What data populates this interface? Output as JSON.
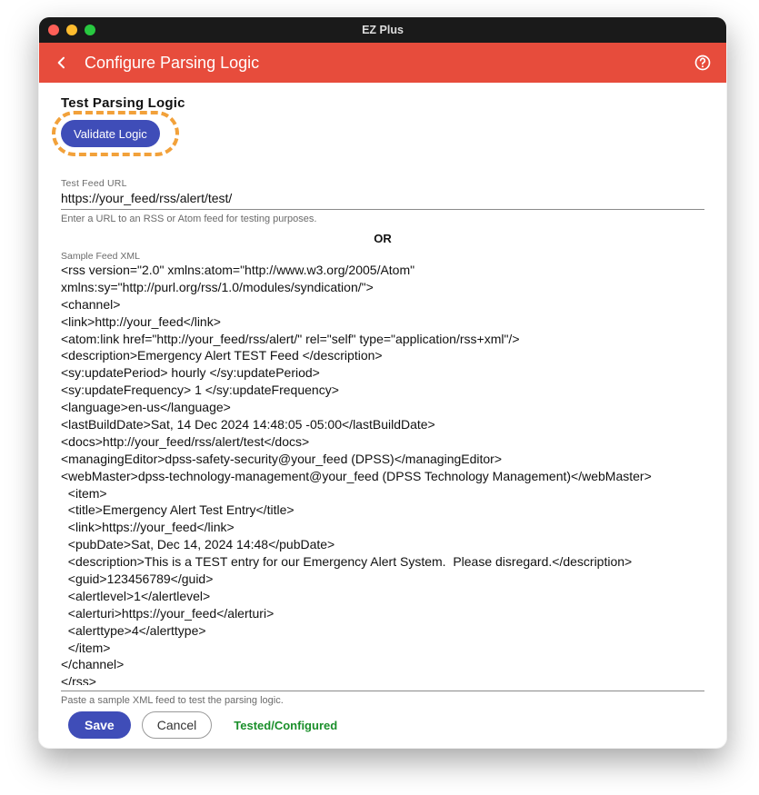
{
  "titlebar": {
    "app_title": "EZ Plus"
  },
  "header": {
    "title": "Configure Parsing Logic"
  },
  "section": {
    "title": "Test Parsing Logic"
  },
  "buttons": {
    "validate": "Validate Logic",
    "save": "Save",
    "cancel": "Cancel"
  },
  "fields": {
    "test_feed_url": {
      "label": "Test Feed URL",
      "value": "https://your_feed/rss/alert/test/",
      "hint": "Enter a URL to an RSS or Atom feed for testing purposes."
    },
    "or_label": "OR",
    "sample_xml": {
      "label": "Sample Feed XML",
      "value": "<rss version=\"2.0\" xmlns:atom=\"http://www.w3.org/2005/Atom\" xmlns:sy=\"http://purl.org/rss/1.0/modules/syndication/\">\n<channel>\n<link>http://your_feed</link>\n<atom:link href=\"http://your_feed/rss/alert/\" rel=\"self\" type=\"application/rss+xml\"/>\n<description>Emergency Alert TEST Feed </description>\n<sy:updatePeriod> hourly </sy:updatePeriod>\n<sy:updateFrequency> 1 </sy:updateFrequency>\n<language>en-us</language>\n<lastBuildDate>Sat, 14 Dec 2024 14:48:05 -05:00</lastBuildDate>\n<docs>http://your_feed/rss/alert/test</docs>\n<managingEditor>dpss-safety-security@your_feed (DPSS)</managingEditor>\n<webMaster>dpss-technology-management@your_feed (DPSS Technology Management)</webMaster>\n  <item>\n  <title>Emergency Alert Test Entry</title>\n  <link>https://your_feed</link>\n  <pubDate>Sat, Dec 14, 2024 14:48</pubDate>\n  <description>This is a TEST entry for our Emergency Alert System.  Please disregard.</description>\n  <guid>123456789</guid>\n  <alertlevel>1</alertlevel>\n  <alerturi>https://your_feed</alerturi>\n  <alerttype>4</alerttype>\n  </item>\n</channel>\n</rss>",
      "hint": "Paste a sample XML feed to test the parsing logic."
    }
  },
  "status": {
    "tested_configured": "Tested/Configured"
  }
}
